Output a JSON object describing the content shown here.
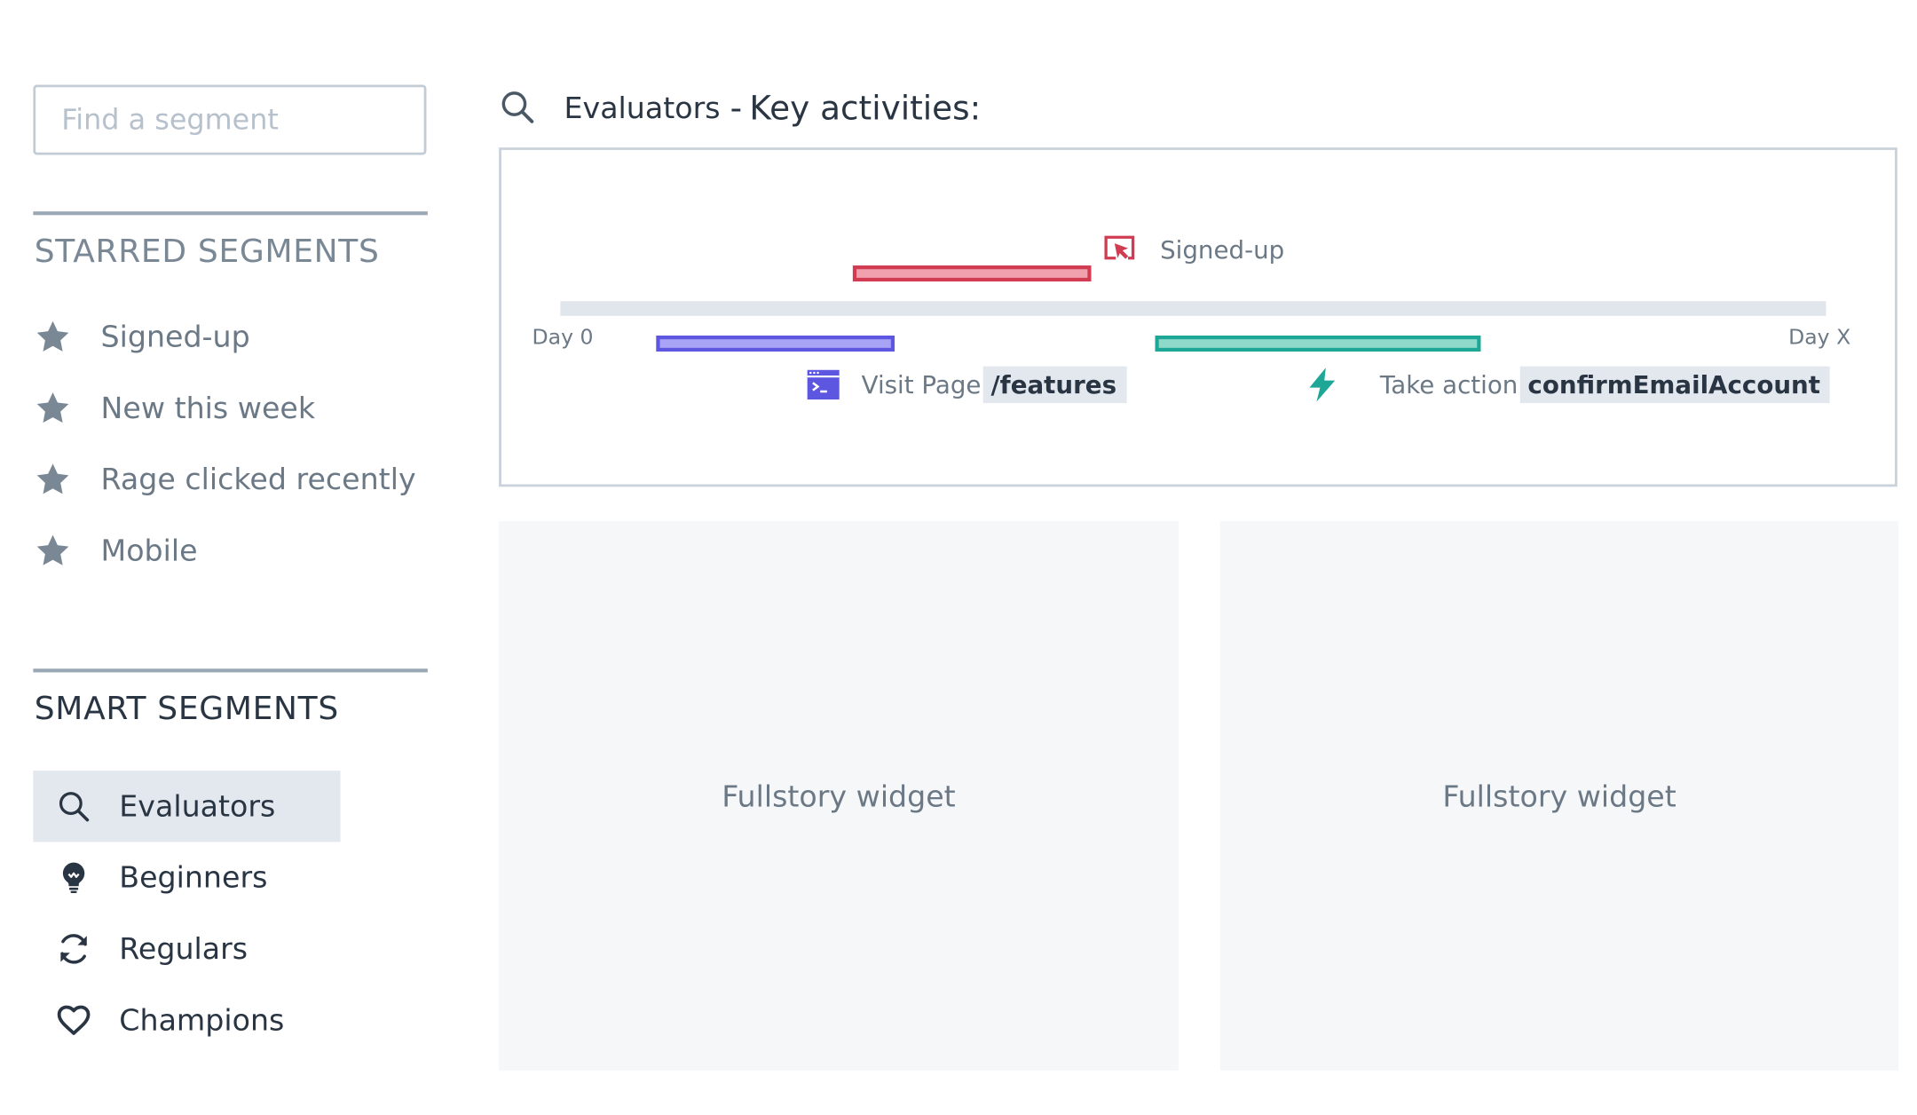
{
  "sidebar": {
    "search": {
      "placeholder": "Find a segment",
      "value": ""
    },
    "starred": {
      "title": "STARRED SEGMENTS",
      "items": [
        {
          "label": "Signed-up",
          "icon": "star-icon"
        },
        {
          "label": "New this week",
          "icon": "star-icon"
        },
        {
          "label": "Rage clicked recently",
          "icon": "star-icon"
        },
        {
          "label": "Mobile",
          "icon": "star-icon"
        }
      ]
    },
    "smart": {
      "title": "SMART SEGMENTS",
      "items": [
        {
          "label": "Evaluators",
          "icon": "search-icon",
          "active": true
        },
        {
          "label": "Beginners",
          "icon": "lightbulb-icon"
        },
        {
          "label": "Regulars",
          "icon": "refresh-icon"
        },
        {
          "label": "Champions",
          "icon": "heart-icon"
        }
      ]
    }
  },
  "main": {
    "header": {
      "segment": "Evaluators",
      "separator": "-",
      "title": "Key activities:"
    },
    "timeline": {
      "start_label": "Day 0",
      "end_label": "Day X",
      "events": {
        "signed_up": {
          "label": "Signed-up",
          "icon": "cursor-click-icon",
          "color": "#d23c52"
        },
        "visit_page": {
          "label": "Visit Page",
          "value": "/features",
          "icon": "browser-terminal-icon",
          "color": "#5c56e0"
        },
        "take_action": {
          "label": "Take action",
          "value": "confirmEmailAccount",
          "icon": "lightning-icon",
          "color": "#1ea796"
        }
      }
    },
    "widgets": [
      {
        "label": "Fullstory widget"
      },
      {
        "label": "Fullstory widget"
      }
    ]
  }
}
